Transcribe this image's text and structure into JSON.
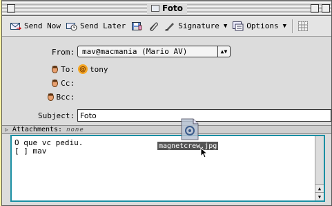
{
  "window": {
    "title": "Foto"
  },
  "toolbar": {
    "send_now": "Send Now",
    "send_later": "Send Later",
    "signature": "Signature",
    "options": "Options"
  },
  "header": {
    "from_label": "From:",
    "from_value": "mav@macmania (Mario AV)",
    "to_label": "To:",
    "to_value": "tony",
    "cc_label": "Cc:",
    "bcc_label": "Bcc:",
    "subject_label": "Subject:",
    "subject_value": "Foto"
  },
  "attachments": {
    "label": "Attachments:",
    "value": "none"
  },
  "message": {
    "line1": "O que vc pediu.",
    "line2": "[ ] mav"
  },
  "drag": {
    "filename": "magnetcrew.jpg"
  },
  "colors": {
    "background": "#fff7a8",
    "body_border": "#1a8fa3",
    "at_badge": "#f5a623"
  }
}
